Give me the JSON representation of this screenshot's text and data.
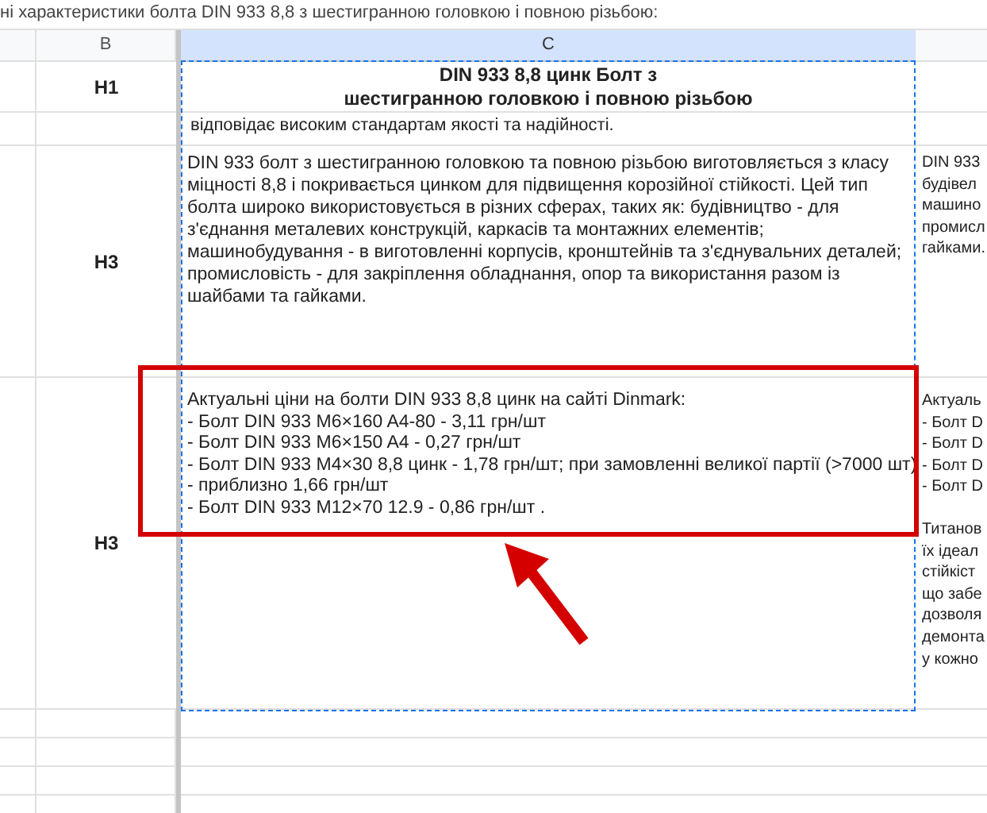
{
  "caption": "ні характеристики болта DIN 933 8,8 з шестигранною головкою і повною різьбою:",
  "columns": [
    {
      "label": "B",
      "selected": false
    },
    {
      "label": "C",
      "selected": true
    }
  ],
  "rows": [
    {
      "header": "H1",
      "c_lines": [
        "DIN 933 8,8 цинк Болт з",
        "шестигранною головкою і повною різьбою"
      ],
      "kind": "heading"
    },
    {
      "c_lines": [
        "відповідає високим стандартам якості та надійності."
      ],
      "kind": "clipped"
    },
    {
      "header": "H3",
      "c_lines": [
        "DIN 933 болт з шестигранною головкою та повною різьбою виготовляється з класу міцності 8,8 і покривається цинком для підвищення корозійної стійкості. Цей тип болта широко використовується в різних сферах, таких як: будівництво - для з'єднання металевих конструкцій, каркасів та монтажних елементів; машинобудування - в виготовленні корпусів, кронштейнів та з'єднувальних деталей; промисловість - для закріплення обладнання, опор та використання разом із шайбами та гайками."
      ],
      "d_lines": [
        "DIN 933",
        "будівел",
        "машино",
        "промисл",
        "гайками."
      ],
      "kind": "paragraph"
    },
    {
      "header": "H3",
      "c_lines": [
        "Актуальні ціни на болти DIN 933 8,8 цинк на сайті Dinmark:",
        "- Болт DIN 933 M6×160 A4-80 - 3,11 грн/шт",
        "- Болт DIN 933 M6×150 A4 - 0,27 грн/шт",
        "- Болт DIN 933 M4×30 8,8 цинк - 1,78 грн/шт; при замовленні великої партії (>7000 шт)",
        "- приблизно 1,66 грн/шт",
        "- Болт DIN 933 M12×70 12.9 - 0,86 грн/шт ."
      ],
      "d_lines": [
        "Актуаль",
        "- Болт D",
        "- Болт D",
        "- Болт D",
        "- Болт D"
      ],
      "d_lines_2": [
        "Титанов",
        "їх ідеал",
        "стійкіст",
        "що забе",
        "дозволя",
        "демонта",
        "у кожно"
      ],
      "kind": "list"
    }
  ]
}
